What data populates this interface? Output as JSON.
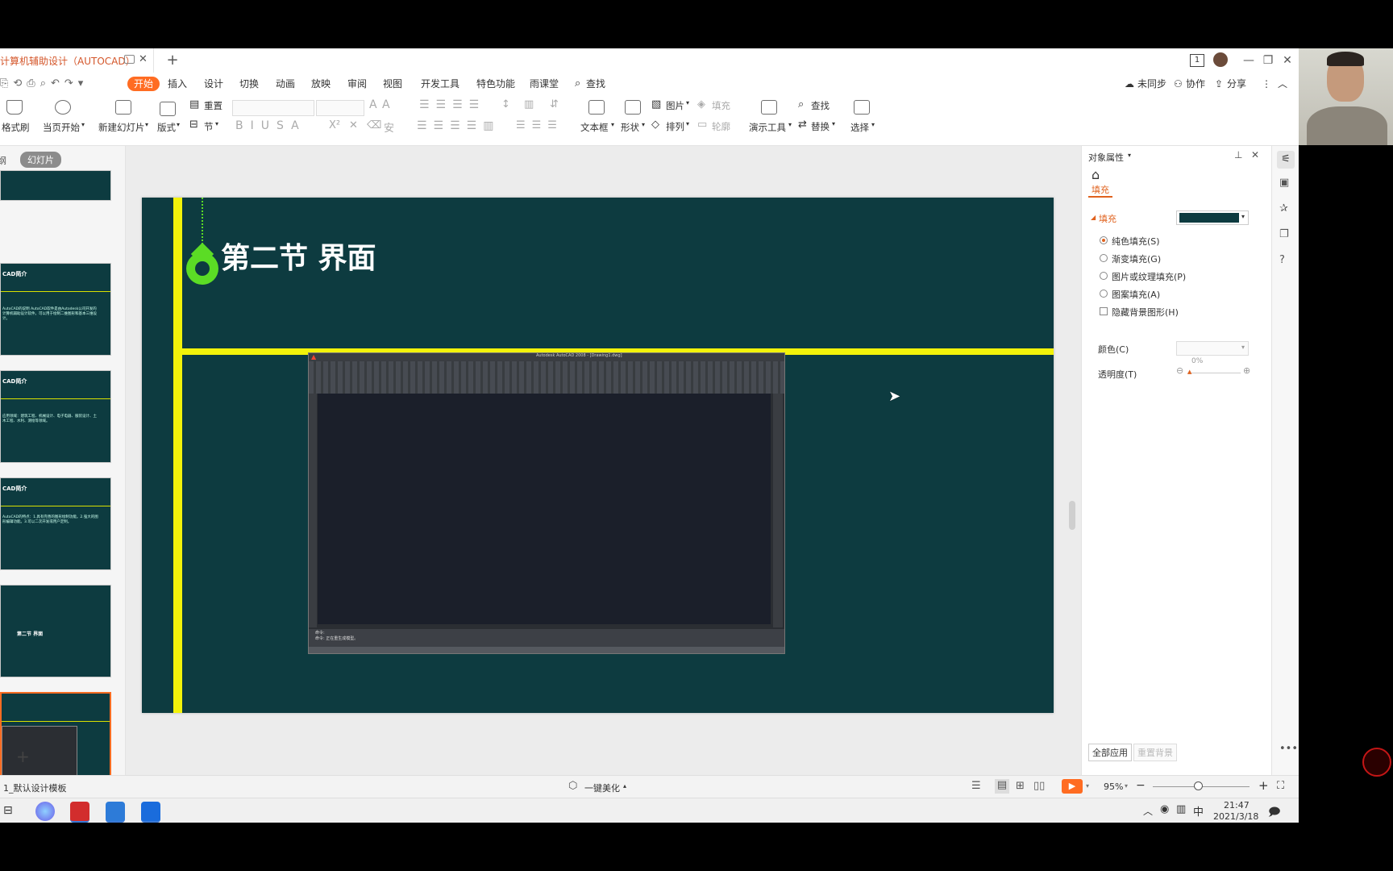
{
  "title_tab": {
    "label": "计算机辅助设计（AUTOCAD）"
  },
  "titlebar": {
    "page_badge": "1"
  },
  "menu": {
    "items": [
      "开始",
      "插入",
      "设计",
      "切换",
      "动画",
      "放映",
      "审阅",
      "视图",
      "开发工具",
      "特色功能",
      "雨课堂",
      "查找"
    ],
    "right": {
      "sync": "未同步",
      "collab": "协作",
      "share": "分享"
    }
  },
  "ribbon": {
    "format_painter": "格式刷",
    "from_current": "当页开始",
    "new_slide": "新建幻灯片",
    "layout": "版式",
    "reset": "重置",
    "section": "节",
    "textbox": "文本框",
    "shape": "形状",
    "picture": "图片",
    "fill": "填充",
    "arrange": "排列",
    "outline": "轮廓",
    "present_tools": "演示工具",
    "find": "查找",
    "replace": "替换",
    "select": "选择"
  },
  "left_panel": {
    "tab_outline": "大纲",
    "tab_slides": "幻灯片",
    "thumbs": [
      {
        "title": "CAD简介",
        "text": "AutoCAD的说明 AutoCAD软件是由Autodesk公司开发的计算机辅助设计软件。可以用于绘制二维图形和基本三维设计。"
      },
      {
        "title": "CAD简介",
        "text": "应用领域：建筑工程、机械设计、电子电器、服装设计、土木工程、水利、测绘等领域。"
      },
      {
        "title": "CAD简介",
        "text": "AutoCAD的特点：1.具有完善的图形绘制功能。2.强大的图形编辑功能。3.可以二次开发或用户定制。"
      },
      {
        "title": "第二节 界面",
        "text": ""
      },
      {
        "title": "",
        "text": ""
      }
    ]
  },
  "slide": {
    "title": "第二节 界面",
    "acad_title": "Autodesk AutoCAD 2008 - [Drawing1.dwg]",
    "acad_cmd1": "命令:",
    "acad_cmd2": "命令: 正在重生成模型。"
  },
  "right_panel": {
    "header": "对象属性",
    "fill_tab": "填充",
    "fill_section": "填充",
    "fill_color": "#0d3b40",
    "options": [
      "纯色填充(S)",
      "渐变填充(G)",
      "图片或纹理填充(P)",
      "图案填充(A)"
    ],
    "hide_bg": "隐藏背景图形(H)",
    "color_label": "颜色(C)",
    "transparency_label": "透明度(T)",
    "transparency_value": "0%",
    "apply_all": "全部应用",
    "reset_bg": "重置背景"
  },
  "status": {
    "template": "1_默认设计模板",
    "beautify": "一键美化",
    "zoom": "95%"
  },
  "taskbar": {
    "ime": "中",
    "time": "21:47",
    "date": "2021/3/18"
  },
  "colors": {
    "accent": "#ff6c22",
    "slide_bg": "#0d3b40",
    "slide_yellow": "#f2f20a",
    "slide_green": "#5bdc25"
  }
}
